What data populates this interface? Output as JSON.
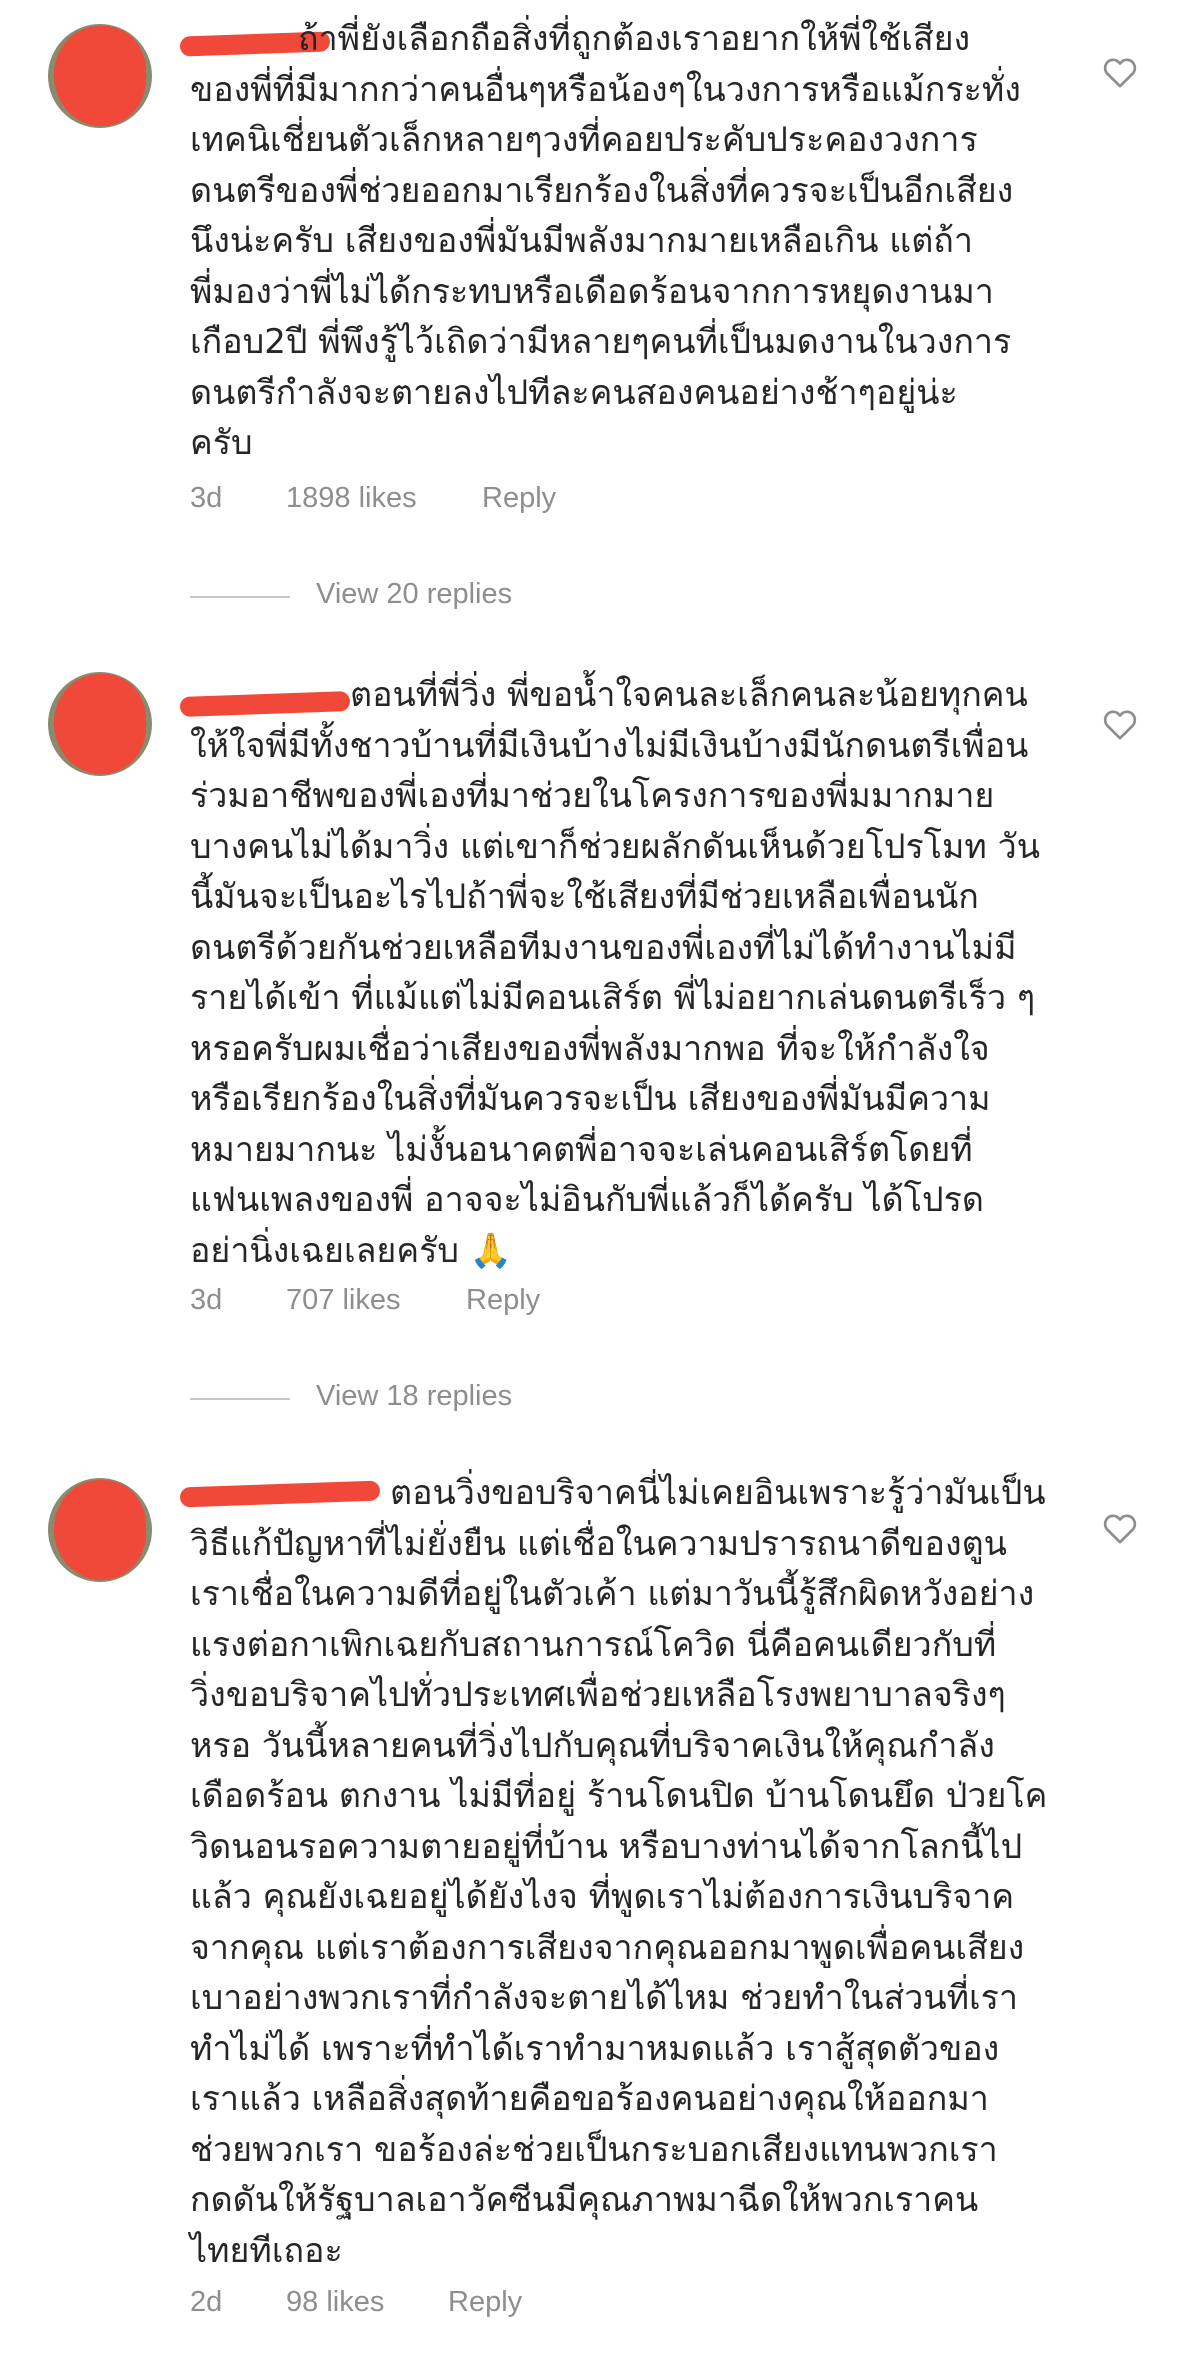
{
  "comments": [
    {
      "lines": [
        "ถ้าพี่ยังเลือกถือสิ่งที่ถูกต้องเราอยากให้พี่ใช้เสียง",
        "ของพี่ที่มีมากกว่าคนอื่นๆหรือน้องๆในวงการหรือแม้กระทั่ง",
        "เทคนิเชี่ยนตัวเล็กหลายๆวงที่คอยประคับประคองวงการ",
        "ดนตรีของพี่ช่วยออกมาเรียกร้องในสิ่งที่ควรจะเป็นอีกเสียง",
        "นึงน่ะครับ เสียงของพี่มันมีพลังมากมายเหลือเกิน แต่ถ้า",
        "พี่มองว่าพี่ไม่ได้กระทบหรือเดือดร้อนจากการหยุดงานมา",
        "เกือบ2ปี พี่พึงรู้ไว้เถิดว่ามีหลายๆคนที่เป็นมดงานในวงการ",
        "ดนตรีกำลังจะตายลงไปทีละคนสองคนอย่างช้าๆอยู่น่ะ",
        "ครับ"
      ],
      "time": "3d",
      "likes": "1898 likes",
      "reply": "Reply",
      "view_replies": "View 20 replies"
    },
    {
      "lines": [
        "ตอนที่พี่วิ่ง พี่ขอน้ำใจคนละเล็กคนละน้อยทุกคน",
        "ให้ใจพี่มีทั้งชาวบ้านที่มีเงินบ้างไม่มีเงินบ้างมีนักดนตรีเพื่อน",
        "ร่วมอาชีพของพี่เองที่มาช่วยในโครงการของพี่มมากมาย",
        "บางคนไม่ได้มาวิ่ง แต่เขาก็ช่วยผลักดันเห็นด้วยโปรโมท วัน",
        "นี้มันจะเป็นอะไรไปถ้าพี่จะใช้เสียงที่มีช่วยเหลือเพื่อนนัก",
        "ดนตรีด้วยกันช่วยเหลือทีมงานของพี่เองที่ไม่ได้ทำงานไม่มี",
        "รายได้เข้า ที่แม้แต่ไม่มีคอนเสิร์ต พี่ไม่อยากเล่นดนตรีเร็ว ๆ",
        "หรอครับผมเชื่อว่าเสียงของพี่พลังมากพอ ที่จะให้กำลังใจ",
        "หรือเรียกร้องในสิ่งที่มันควรจะเป็น เสียงของพี่มันมีความ",
        "หมายมากนะ ไม่งั้นอนาคตพี่อาจจะเล่นคอนเสิร์ตโดยที่",
        "แฟนเพลงของพี่ อาจจะไม่อินกับพี่แล้วก็ได้ครับ ได้โปรด",
        "อย่านิ่งเฉยเลยครับ 🙏"
      ],
      "time": "3d",
      "likes": "707 likes",
      "reply": "Reply",
      "view_replies": "View 18 replies"
    },
    {
      "lines": [
        "ตอนวิ่งขอบริจาคนี่ไม่เคยอินเพราะรู้ว่ามันเป็น",
        "วิธีแก้ปัญหาที่ไม่ยั่งยืน แต่เชื่อในความปรารถนาดีของตูน",
        "เราเชื่อในความดีที่อยู่ในตัวเค้า แต่มาวันนี้รู้สึกผิดหวังอย่าง",
        "แรงต่อกาเพิกเฉยกับสถานการณ์โควิด นี่คือคนเดียวกับที่",
        "วิ่งขอบริจาคไปทั่วประเทศเพื่อช่วยเหลือโรงพยาบาลจริงๆ",
        "หรอ วันนี้หลายคนที่วิ่งไปกับคุณที่บริจาคเงินให้คุณกำลัง",
        "เดือดร้อน ตกงาน ไม่มีที่อยู่ ร้านโดนปิด บ้านโดนยึด ป่วยโค",
        "วิดนอนรอความตายอยู่ที่บ้าน หรือบางท่านได้จากโลกนี้ไป",
        "แล้ว คุณยังเฉยอยู่ได้ยังไงจ ที่พูดเราไม่ต้องการเงินบริจาค",
        "จากคุณ แต่เราต้องการเสียงจากคุณออกมาพูดเพื่อคนเสียง",
        "เบาอย่างพวกเราที่กำลังจะตายได้ไหม ช่วยทำในส่วนที่เรา",
        "ทำไม่ได้ เพราะที่ทำได้เราทำมาหมดแล้ว เราสู้สุดตัวของ",
        "เราแล้ว เหลือสิ่งสุดท้ายคือขอร้องคนอย่างคุณให้ออกมา",
        "ช่วยพวกเรา ขอร้องล่ะช่วยเป็นกระบอกเสียงแทนพวกเรา",
        "กดดันให้รัฐบาลเอาวัคซีนมีคุณภาพมาฉีดให้พวกเราคน",
        "ไทยทีเถอะ"
      ],
      "time": "2d",
      "likes": "98 likes",
      "reply": "Reply"
    }
  ],
  "colors": {
    "text": "#262626",
    "meta": "#8e8e8e",
    "redaction": "#f0493a",
    "rule": "#c7c7c7"
  },
  "icons": {
    "like": "heart-outline-icon"
  }
}
